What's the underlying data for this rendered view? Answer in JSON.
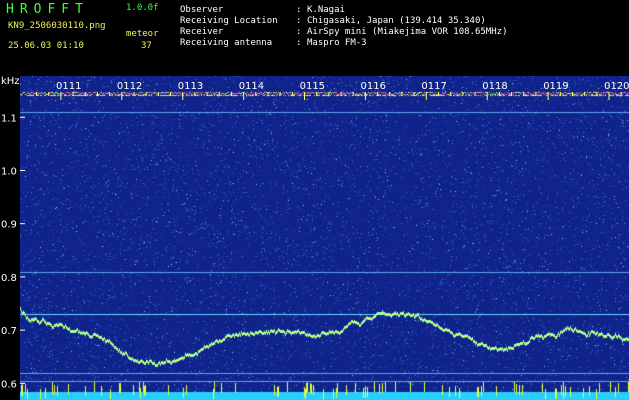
{
  "app": {
    "title": "HROFFT",
    "version": "1.0.0f"
  },
  "file": {
    "name": "KN9_2506030110.png",
    "datetime": "25.06.03 01:10"
  },
  "meteor": {
    "label": "meteor",
    "count": "37"
  },
  "station": [
    {
      "label": "Observer",
      "value": "K.Nagai"
    },
    {
      "label": "Receiving Location",
      "value": "Chigasaki, Japan (139.414 35.340)"
    },
    {
      "label": "Receiver",
      "value": "AirSpy mini (Miakejima VOR 108.65MHz)"
    },
    {
      "label": "Receiving antenna",
      "value": "Maspro FM-3"
    }
  ],
  "colon": ":",
  "chart_data": {
    "type": "heatmap",
    "ylabel": "kHz",
    "yticks": [
      "1.1",
      "1.0",
      "0.9",
      "0.8",
      "0.7",
      "0.6"
    ],
    "ylim": [
      0.58,
      1.17
    ],
    "xticks": [
      "0111",
      "0112",
      "0113",
      "0114",
      "0115",
      "0116",
      "0117",
      "0118",
      "0119",
      "0120"
    ],
    "colors": {
      "background": "#10238a",
      "noise": "#2f63d8",
      "signal": "#c8ff6a",
      "carrier": "#ff6ab0",
      "ticks": "#ffff66"
    }
  }
}
